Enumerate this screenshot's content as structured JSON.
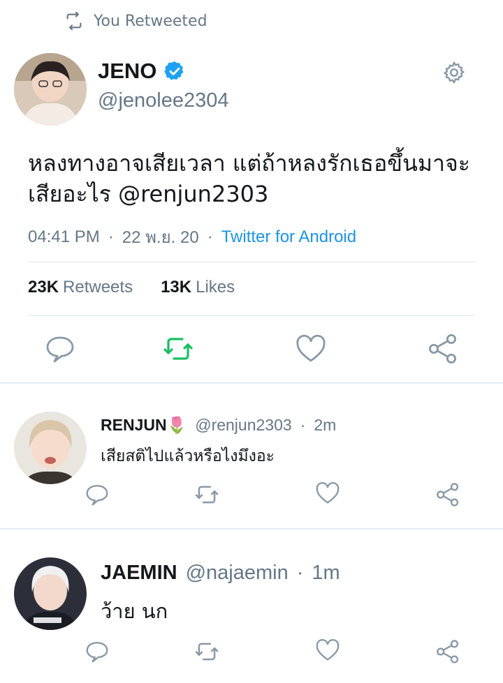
{
  "retweet_header": {
    "icon": "retweet-icon",
    "label": "You Retweeted"
  },
  "tweet": {
    "author_name": "JENO",
    "author_handle": "@jenolee2304",
    "verified": true,
    "text": "หลงทางอาจเสียเวลา แต่ถ้าหลงรักเธอขึ้นมาจะเสียอะไร @renjun2303",
    "time": "04:41 PM",
    "date": "22 พ.ย. 20",
    "source": "Twitter for Android",
    "retweets_count": "23K",
    "retweets_label": "Retweets",
    "likes_count": "13K",
    "likes_label": "Likes"
  },
  "replies": [
    {
      "name": "RENJUN🌷",
      "handle": "@renjun2303",
      "time": "2m",
      "text": "เสียสติไปแล้วหรือไงมึงอะ"
    },
    {
      "name": "JAEMIN",
      "handle": "@najaemin",
      "time": "1m",
      "text": "ว้าย นก"
    }
  ],
  "colors": {
    "accent_blue": "#1b95e0",
    "retweet_green": "#17bf63",
    "secondary_text": "#657786",
    "icon_gray": "#8899a6"
  }
}
